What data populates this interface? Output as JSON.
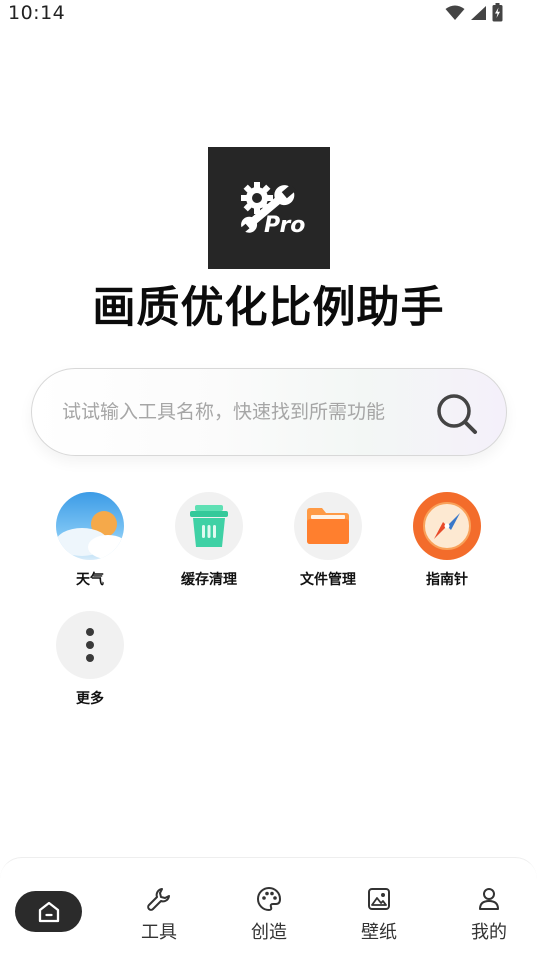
{
  "status_bar": {
    "time": "10:14",
    "icons": [
      "wifi-icon",
      "signal-icon",
      "battery-charging-icon"
    ]
  },
  "app": {
    "logo_text": "Pro",
    "title": "画质优化比例助手"
  },
  "search": {
    "placeholder": "试试输入工具名称，快速找到所需功能"
  },
  "tools": [
    {
      "label": "天气",
      "icon": "weather-icon"
    },
    {
      "label": "缓存清理",
      "icon": "trash-icon"
    },
    {
      "label": "文件管理",
      "icon": "folder-icon"
    },
    {
      "label": "指南针",
      "icon": "compass-icon"
    },
    {
      "label": "更多",
      "icon": "more-icon"
    }
  ],
  "nav": [
    {
      "label": "",
      "icon": "home-icon",
      "active": true
    },
    {
      "label": "工具",
      "icon": "wrench-icon"
    },
    {
      "label": "创造",
      "icon": "palette-icon"
    },
    {
      "label": "壁纸",
      "icon": "image-icon"
    },
    {
      "label": "我的",
      "icon": "user-icon"
    }
  ],
  "colors": {
    "accent_dark": "#2b2b2b",
    "weather_blue": "#4aa7e8",
    "cache_green": "#3fcfa3",
    "folder_orange": "#ff8a3d",
    "compass_orange": "#f26a2c"
  }
}
